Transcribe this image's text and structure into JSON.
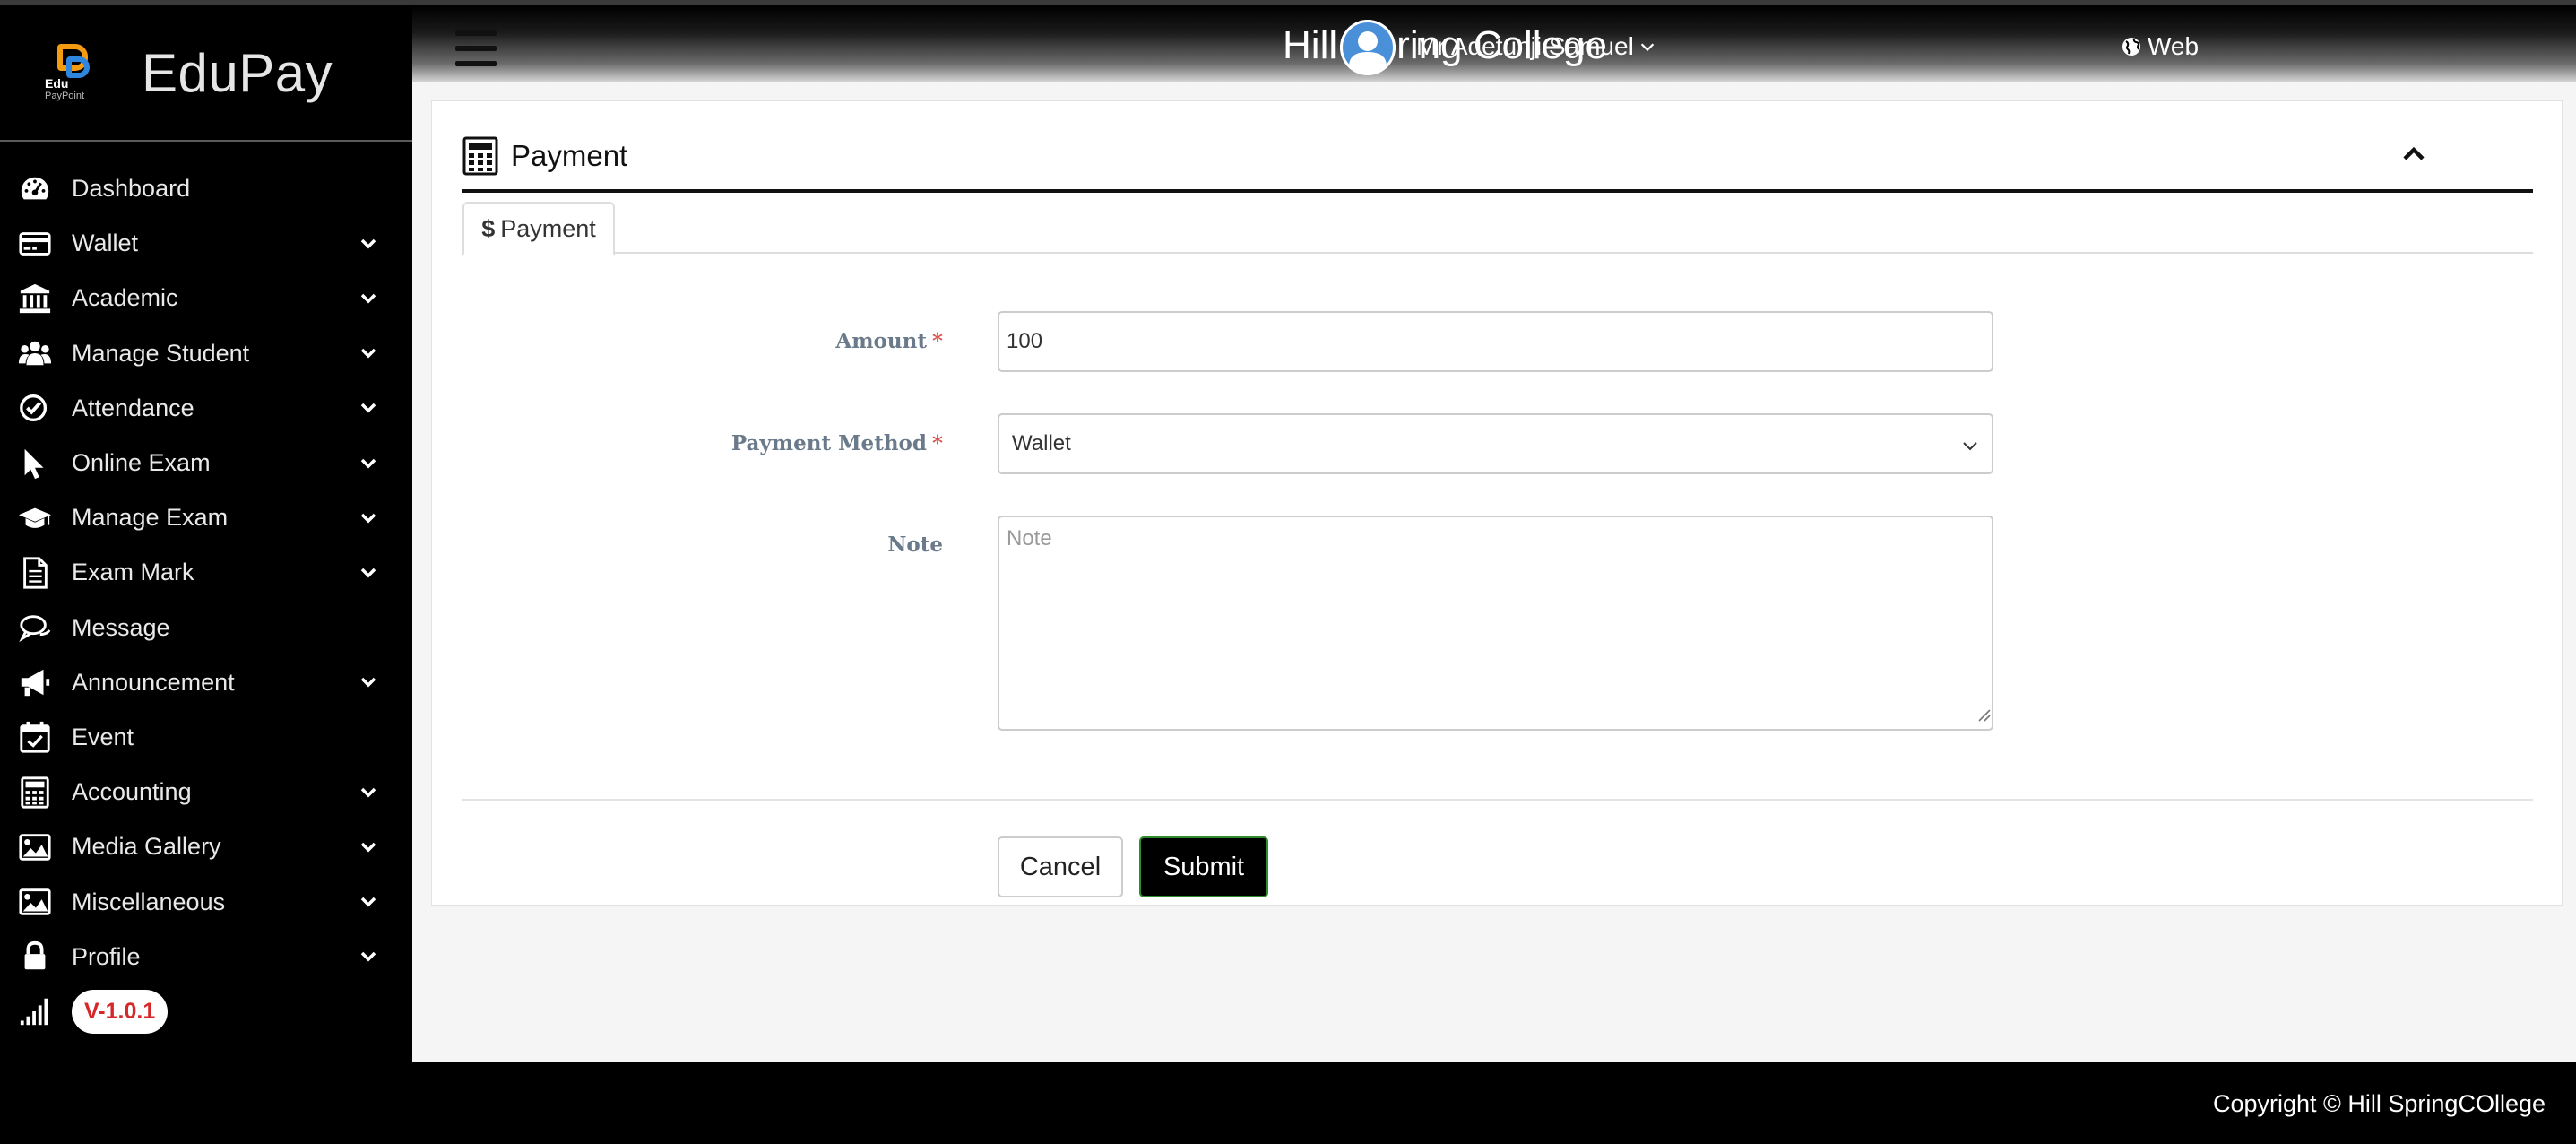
{
  "brand": {
    "name": "EduPay",
    "logo_line1": "Edu",
    "logo_line2": "PayPoint"
  },
  "header": {
    "title": "Hill Spring College",
    "web_label": "Web",
    "user_name": "Mr Adetunji Samuel"
  },
  "sidebar": {
    "items": [
      {
        "label": "Dashboard",
        "icon": "dashboard-icon",
        "has_submenu": false
      },
      {
        "label": "Wallet",
        "icon": "credit-card-icon",
        "has_submenu": true
      },
      {
        "label": "Academic",
        "icon": "bank-icon",
        "has_submenu": true
      },
      {
        "label": "Manage Student",
        "icon": "users-icon",
        "has_submenu": true
      },
      {
        "label": "Attendance",
        "icon": "check-circle-icon",
        "has_submenu": true
      },
      {
        "label": "Online Exam",
        "icon": "cursor-icon",
        "has_submenu": true
      },
      {
        "label": "Manage Exam",
        "icon": "graduation-cap-icon",
        "has_submenu": true
      },
      {
        "label": "Exam Mark",
        "icon": "document-icon",
        "has_submenu": true
      },
      {
        "label": "Message",
        "icon": "chat-icon",
        "has_submenu": false
      },
      {
        "label": "Announcement",
        "icon": "megaphone-icon",
        "has_submenu": true
      },
      {
        "label": "Event",
        "icon": "calendar-check-icon",
        "has_submenu": false
      },
      {
        "label": "Accounting",
        "icon": "calculator-icon",
        "has_submenu": true
      },
      {
        "label": "Media Gallery",
        "icon": "image-icon",
        "has_submenu": true
      },
      {
        "label": "Miscellaneous",
        "icon": "image-icon",
        "has_submenu": true
      },
      {
        "label": "Profile",
        "icon": "lock-icon",
        "has_submenu": true
      }
    ],
    "version": "V-1.0.1"
  },
  "panel": {
    "title": "Payment",
    "tab_label": "Payment",
    "tab_icon_glyph": "$"
  },
  "form": {
    "amount_label": "Amount",
    "amount_value": "100",
    "payment_method_label": "Payment Method",
    "payment_method_value": "Wallet",
    "note_label": "Note",
    "note_placeholder": "Note",
    "required_mark": "*",
    "cancel_label": "Cancel",
    "submit_label": "Submit"
  },
  "footer": {
    "copyright": "Copyright © Hill SpringCOllege"
  },
  "colors": {
    "sidebar_bg": "#000000",
    "required": "#d9534f",
    "version_text": "#d62828",
    "submit_border": "#2e8b2e",
    "label_text": "#6a7a8a"
  }
}
